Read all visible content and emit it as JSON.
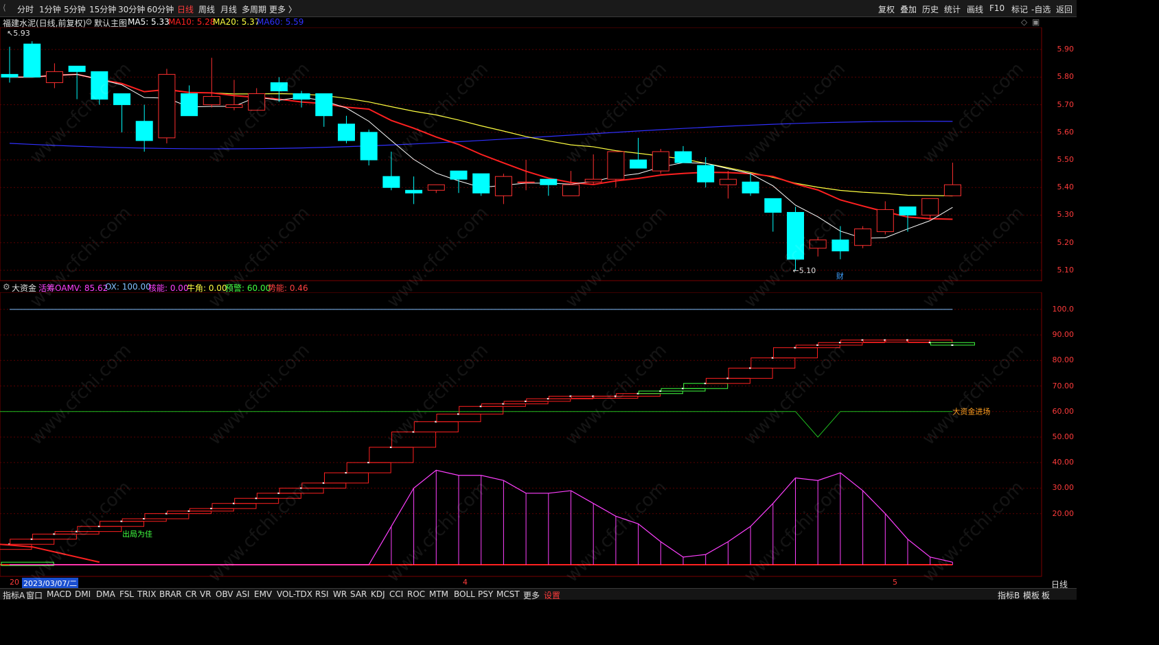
{
  "toolbar": {
    "left": [
      "分时",
      "1分钟",
      "5分钟",
      "15分钟",
      "30分钟",
      "60分钟",
      "日线",
      "周线",
      "月线",
      "多周期",
      "更多 〉"
    ],
    "active_index": 6,
    "right": [
      "复权",
      "叠加",
      "历史",
      "统计",
      "画线",
      "F10",
      "标记",
      "-自选",
      "返回"
    ]
  },
  "main_chart": {
    "stock_name": "福建水泥(日线,前复权)",
    "template": "默认主图",
    "ma": [
      {
        "label": "MA5: 5.33",
        "color": "#ffffff"
      },
      {
        "label": "MA10: 5.28",
        "color": "#ff2020"
      },
      {
        "label": "MA20: 5.37",
        "color": "#ffff40"
      },
      {
        "label": "MA60: 5.59",
        "color": "#3030ff"
      }
    ],
    "high_marker": "5.93",
    "low_marker": "←5.10",
    "event_marker": "财",
    "y_ticks": [
      "5.90",
      "5.80",
      "5.70",
      "5.60",
      "5.50",
      "5.40",
      "5.30",
      "5.20",
      "5.10"
    ],
    "colors": {
      "up": "#ff3030",
      "down": "#00ffff"
    }
  },
  "chart_data": {
    "type": "candlestick",
    "title": "福建水泥(日线,前复权)",
    "ylim": [
      5.06,
      5.98
    ],
    "candles": [
      {
        "o": 5.81,
        "h": 5.91,
        "l": 5.78,
        "c": 5.8
      },
      {
        "o": 5.92,
        "h": 5.93,
        "l": 5.8,
        "c": 5.8
      },
      {
        "o": 5.78,
        "h": 5.85,
        "l": 5.76,
        "c": 5.82
      },
      {
        "o": 5.84,
        "h": 5.84,
        "l": 5.72,
        "c": 5.82
      },
      {
        "o": 5.82,
        "h": 5.82,
        "l": 5.7,
        "c": 5.72
      },
      {
        "o": 5.74,
        "h": 5.74,
        "l": 5.6,
        "c": 5.7
      },
      {
        "o": 5.64,
        "h": 5.7,
        "l": 5.53,
        "c": 5.57
      },
      {
        "o": 5.58,
        "h": 5.83,
        "l": 5.56,
        "c": 5.81
      },
      {
        "o": 5.74,
        "h": 5.77,
        "l": 5.66,
        "c": 5.66
      },
      {
        "o": 5.7,
        "h": 5.87,
        "l": 5.69,
        "c": 5.73
      },
      {
        "o": 5.69,
        "h": 5.79,
        "l": 5.68,
        "c": 5.7
      },
      {
        "o": 5.68,
        "h": 5.76,
        "l": 5.68,
        "c": 5.74
      },
      {
        "o": 5.78,
        "h": 5.8,
        "l": 5.71,
        "c": 5.75
      },
      {
        "o": 5.74,
        "h": 5.75,
        "l": 5.69,
        "c": 5.72
      },
      {
        "o": 5.74,
        "h": 5.74,
        "l": 5.62,
        "c": 5.66
      },
      {
        "o": 5.63,
        "h": 5.66,
        "l": 5.56,
        "c": 5.57
      },
      {
        "o": 5.6,
        "h": 5.61,
        "l": 5.48,
        "c": 5.5
      },
      {
        "o": 5.44,
        "h": 5.53,
        "l": 5.39,
        "c": 5.4
      },
      {
        "o": 5.39,
        "h": 5.44,
        "l": 5.34,
        "c": 5.38
      },
      {
        "o": 5.39,
        "h": 5.41,
        "l": 5.38,
        "c": 5.41
      },
      {
        "o": 5.46,
        "h": 5.46,
        "l": 5.38,
        "c": 5.43
      },
      {
        "o": 5.45,
        "h": 5.45,
        "l": 5.37,
        "c": 5.38
      },
      {
        "o": 5.37,
        "h": 5.45,
        "l": 5.34,
        "c": 5.44
      },
      {
        "o": 5.42,
        "h": 5.5,
        "l": 5.39,
        "c": 5.42
      },
      {
        "o": 5.43,
        "h": 5.43,
        "l": 5.37,
        "c": 5.41
      },
      {
        "o": 5.37,
        "h": 5.46,
        "l": 5.37,
        "c": 5.41
      },
      {
        "o": 5.42,
        "h": 5.52,
        "l": 5.41,
        "c": 5.43
      },
      {
        "o": 5.43,
        "h": 5.53,
        "l": 5.4,
        "c": 5.53
      },
      {
        "o": 5.5,
        "h": 5.58,
        "l": 5.47,
        "c": 5.47
      },
      {
        "o": 5.46,
        "h": 5.54,
        "l": 5.45,
        "c": 5.53
      },
      {
        "o": 5.53,
        "h": 5.55,
        "l": 5.49,
        "c": 5.49
      },
      {
        "o": 5.48,
        "h": 5.51,
        "l": 5.4,
        "c": 5.42
      },
      {
        "o": 5.41,
        "h": 5.46,
        "l": 5.36,
        "c": 5.43
      },
      {
        "o": 5.42,
        "h": 5.45,
        "l": 5.37,
        "c": 5.38
      },
      {
        "o": 5.36,
        "h": 5.36,
        "l": 5.24,
        "c": 5.31
      },
      {
        "o": 5.31,
        "h": 5.33,
        "l": 5.1,
        "c": 5.14
      },
      {
        "o": 5.18,
        "h": 5.22,
        "l": 5.15,
        "c": 5.21
      },
      {
        "o": 5.21,
        "h": 5.26,
        "l": 5.14,
        "c": 5.17
      },
      {
        "o": 5.19,
        "h": 5.26,
        "l": 5.18,
        "c": 5.25
      },
      {
        "o": 5.24,
        "h": 5.35,
        "l": 5.23,
        "c": 5.32
      },
      {
        "o": 5.33,
        "h": 5.33,
        "l": 5.24,
        "c": 5.3
      },
      {
        "o": 5.3,
        "h": 5.35,
        "l": 5.28,
        "c": 5.36
      },
      {
        "o": 5.37,
        "h": 5.49,
        "l": 5.37,
        "c": 5.41
      }
    ]
  },
  "indicator": {
    "name": "大资金",
    "params": [
      {
        "label": "活筹OAMV: 85.62",
        "color": "#ff40ff"
      },
      {
        "label": "OX: 100.00",
        "color": "#80c0ff"
      },
      {
        "label": "核能: 0.00",
        "color": "#ff40ff"
      },
      {
        "label": "牛角: 0.00",
        "color": "#ffff40"
      },
      {
        "label": "预警: 60.00",
        "color": "#40ff40"
      },
      {
        "label": "势能: 0.46",
        "color": "#ff4040"
      }
    ],
    "y_ticks": [
      "100.0",
      "90.00",
      "80.00",
      "70.00",
      "60.00",
      "50.00",
      "40.00",
      "30.00",
      "20.00"
    ],
    "label_exit": "出局为佳",
    "label_entry": "大资金进场",
    "ylim": [
      0,
      104
    ],
    "oamv": [
      8,
      10,
      12,
      13,
      15,
      17,
      18,
      20,
      21,
      22,
      24,
      26,
      28,
      30,
      32,
      36,
      40,
      46,
      52,
      56,
      59,
      62,
      63,
      64,
      65,
      66,
      66,
      66,
      67,
      68,
      69,
      71,
      73,
      77,
      81,
      85,
      86,
      87,
      88,
      88,
      88,
      87,
      86
    ],
    "energy": [
      0,
      0,
      0,
      0,
      0,
      0,
      0,
      0,
      0,
      0,
      0,
      0,
      0,
      0,
      0,
      0,
      0,
      15,
      30,
      37,
      35,
      35,
      33,
      28,
      28,
      29,
      24,
      19,
      16,
      9,
      3,
      4,
      9,
      15,
      24,
      34,
      33,
      36,
      29,
      20,
      10,
      3,
      1
    ]
  },
  "date_bar": {
    "cursor_date": "2023/03/07/二",
    "m4": "4",
    "m5": "5"
  },
  "bottom_bar": {
    "left": [
      "指标A",
      "窗口",
      "MACD",
      "DMI",
      "DMA",
      "FSL",
      "TRIX",
      "BRAR",
      "CR",
      "VR",
      "OBV",
      "ASI",
      "EMV",
      "VOL-TDX",
      "RSI",
      "WR",
      "SAR",
      "KDJ",
      "CCI",
      "ROC",
      "MTM",
      "BOLL",
      "PSY",
      "MCST",
      "更多",
      "设置"
    ],
    "right": [
      "指标B",
      "模板",
      "板"
    ],
    "period": "日线"
  },
  "watermark": "www.cfchi.com"
}
